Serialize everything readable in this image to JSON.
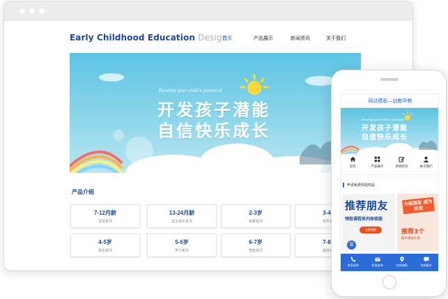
{
  "desktop": {
    "logo_main": "Early Childhood Education",
    "logo_light": "Design",
    "nav": [
      "首页",
      "产品展示",
      "新闻资讯",
      "关于我们"
    ],
    "banner": {
      "subtitle": "Develop your child's potential",
      "line1": "开发孩子潜能",
      "line2": "自信快乐成长"
    },
    "section_title": "产品介绍",
    "products": [
      {
        "age": "7-12月龄",
        "series": "宝宝系列"
      },
      {
        "age": "13-24月龄",
        "series": "宝宝成长系列"
      },
      {
        "age": "2-3岁",
        "series": "启蒙系列"
      },
      {
        "age": "3-4岁",
        "series": "快乐系列"
      },
      {
        "age": "4-5岁",
        "series": "成长系列"
      },
      {
        "age": "5-6岁",
        "series": "学习系列"
      },
      {
        "age": "6-7岁",
        "series": "智能系列"
      },
      {
        "age": "7-8岁",
        "series": "最佳系列"
      }
    ]
  },
  "mobile": {
    "title": "网站模板—幼教早教",
    "banner": {
      "subtitle": "Develop your child's potential",
      "line1": "开发孩子潜能",
      "line2": "自信快乐成长"
    },
    "nav": [
      {
        "label": "首页",
        "icon": "home-icon"
      },
      {
        "label": "产品展示",
        "icon": "grid-icon"
      },
      {
        "label": "新闻资讯",
        "icon": "edit-icon"
      },
      {
        "label": "关于我们",
        "icon": "user-icon"
      }
    ],
    "section_title": "申请免费体验商品",
    "promo1": {
      "headline": "推荐朋友",
      "subline": "领取课程系列体验版",
      "button": "立即领取"
    },
    "promo2": {
      "tag": "介绍朋友 成为好友",
      "headline": "推荐3个",
      "subline": "额外赠送礼物"
    },
    "footer": [
      {
        "label": "电话咨询",
        "icon": "phone-icon"
      },
      {
        "label": "短信咨询",
        "icon": "mail-icon"
      },
      {
        "label": "在线地图",
        "icon": "map-pin-icon"
      },
      {
        "label": "在线留言",
        "icon": "chat-icon"
      }
    ]
  },
  "colors": {
    "brand": "#1d4a94",
    "accent": "#2b6cd8",
    "sky": "#5cc4e3",
    "promo_orange": "#f25c2d"
  }
}
